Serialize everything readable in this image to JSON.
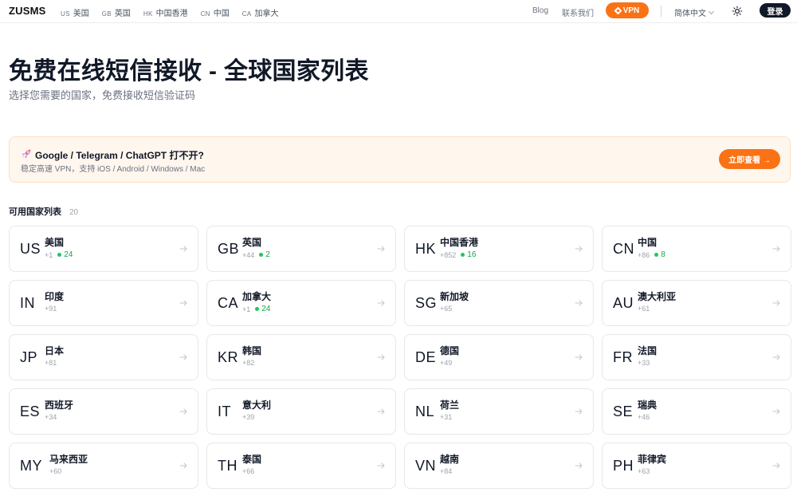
{
  "header": {
    "brand": "ZUSMS",
    "quick_links": [
      {
        "code": "US",
        "name": "美国"
      },
      {
        "code": "GB",
        "name": "英国"
      },
      {
        "code": "HK",
        "name": "中国香港"
      },
      {
        "code": "CN",
        "name": "中国"
      },
      {
        "code": "CA",
        "name": "加拿大"
      }
    ],
    "blog_label": "Blog",
    "contact_label": "联系我们",
    "vpn_label": "VPN",
    "language_label": "简体中文",
    "login_label": "登录",
    "theme_icon": "sun-icon",
    "vpn_icon": "diamond-icon"
  },
  "page": {
    "title": "免费在线短信接收 - 全球国家列表",
    "subtitle": "选择您需要的国家，免费接收短信验证码"
  },
  "promo": {
    "icon": "rocket-icon",
    "title": "Google / Telegram / ChatGPT 打不开?",
    "subtitle": "稳定高速 VPN，支持 iOS / Android / Windows / Mac",
    "button_label": "立即查看 →"
  },
  "countries_section": {
    "title": "可用国家列表",
    "count": "20"
  },
  "countries": [
    {
      "code": "US",
      "name": "美国",
      "dial": "+1",
      "available": "24"
    },
    {
      "code": "GB",
      "name": "英国",
      "dial": "+44",
      "available": "2"
    },
    {
      "code": "HK",
      "name": "中国香港",
      "dial": "+852",
      "available": "16"
    },
    {
      "code": "CN",
      "name": "中国",
      "dial": "+86",
      "available": "8"
    },
    {
      "code": "IN",
      "name": "印度",
      "dial": "+91",
      "available": null
    },
    {
      "code": "CA",
      "name": "加拿大",
      "dial": "+1",
      "available": "24"
    },
    {
      "code": "SG",
      "name": "新加坡",
      "dial": "+65",
      "available": null
    },
    {
      "code": "AU",
      "name": "澳大利亚",
      "dial": "+61",
      "available": null
    },
    {
      "code": "JP",
      "name": "日本",
      "dial": "+81",
      "available": null
    },
    {
      "code": "KR",
      "name": "韩国",
      "dial": "+82",
      "available": null
    },
    {
      "code": "DE",
      "name": "德国",
      "dial": "+49",
      "available": null
    },
    {
      "code": "FR",
      "name": "法国",
      "dial": "+33",
      "available": null
    },
    {
      "code": "ES",
      "name": "西班牙",
      "dial": "+34",
      "available": null
    },
    {
      "code": "IT",
      "name": "意大利",
      "dial": "+39",
      "available": null
    },
    {
      "code": "NL",
      "name": "荷兰",
      "dial": "+31",
      "available": null
    },
    {
      "code": "SE",
      "name": "瑞典",
      "dial": "+46",
      "available": null
    },
    {
      "code": "MY",
      "name": "马来西亚",
      "dial": "+60",
      "available": null
    },
    {
      "code": "TH",
      "name": "泰国",
      "dial": "+66",
      "available": null
    },
    {
      "code": "VN",
      "name": "越南",
      "dial": "+84",
      "available": null
    },
    {
      "code": "PH",
      "name": "菲律宾",
      "dial": "+63",
      "available": null
    }
  ],
  "colors": {
    "accent": "#f97316",
    "available_dot": "#22c55e",
    "available_text": "#16a34a",
    "promo_bg": "#fff6ee",
    "dark_button": "#111827"
  }
}
